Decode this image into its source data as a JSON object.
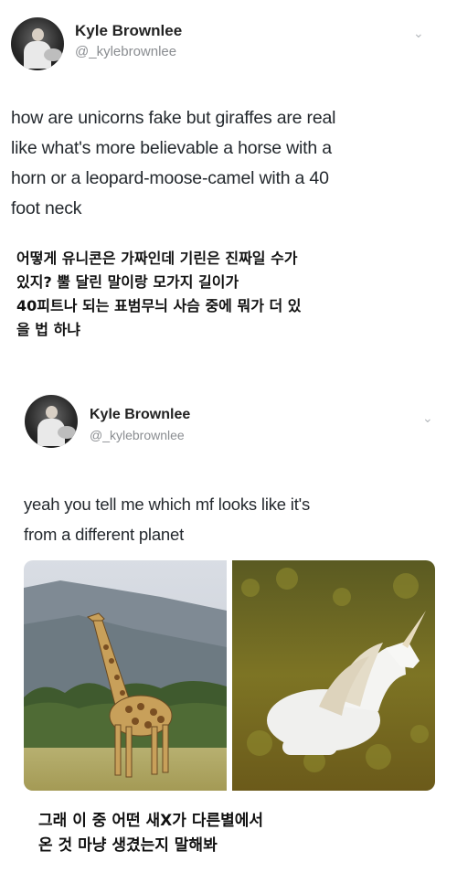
{
  "tweets": [
    {
      "name": "Kyle Brownlee",
      "handle": "@_kylebrownlee",
      "text_lines": [
        "how are unicorns fake but giraffes are real",
        "like what's more believable a horse with a",
        "horn or a leopard-moose-camel with a 40",
        "foot neck"
      ],
      "translation_lines": [
        "어떻게 유니콘은 가짜인데 기린은 진짜일 수가",
        "있지? 뿔 달린 말이랑 모가지 길이가",
        "40피트나 되는 표범무늬 사슴 중에 뭐가 더 있",
        "을 법 하냐"
      ]
    },
    {
      "name": "Kyle Brownlee",
      "handle": "@_kylebrownlee",
      "text_lines": [
        "yeah you tell me which mf looks like it's",
        "from a different planet"
      ],
      "translation_lines": [
        "그래 이 중 어떤 새X가 다른별에서",
        "온 것 마냥 생겼는지 말해봐"
      ]
    }
  ],
  "icons": {
    "avatar": "profile-photo",
    "chevron": "chevron-down-icon"
  },
  "colors": {
    "name": "#222222",
    "handle": "#8a8d91",
    "text": "#24292e",
    "translation": "#111111"
  }
}
